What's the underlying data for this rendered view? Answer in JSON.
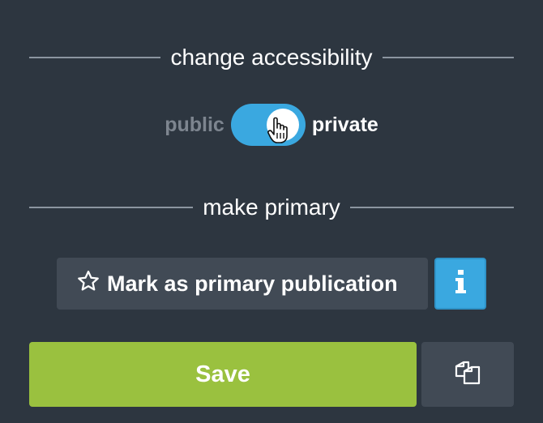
{
  "accessibility_section": {
    "heading": "change accessibility",
    "off_label": "public",
    "on_label": "private",
    "state": "private"
  },
  "primary_section": {
    "heading": "make primary",
    "mark_button_label": "Mark as primary publication"
  },
  "actions": {
    "save_label": "Save"
  },
  "icons": {
    "star": "star-outline-icon",
    "info": "info-icon",
    "copy": "copy-icon",
    "cursor": "hand-pointer-icon"
  },
  "colors": {
    "background": "#2d3640",
    "accent_blue": "#3aa8e0",
    "save_green": "#9ac13f",
    "button_gray": "#414a55"
  }
}
